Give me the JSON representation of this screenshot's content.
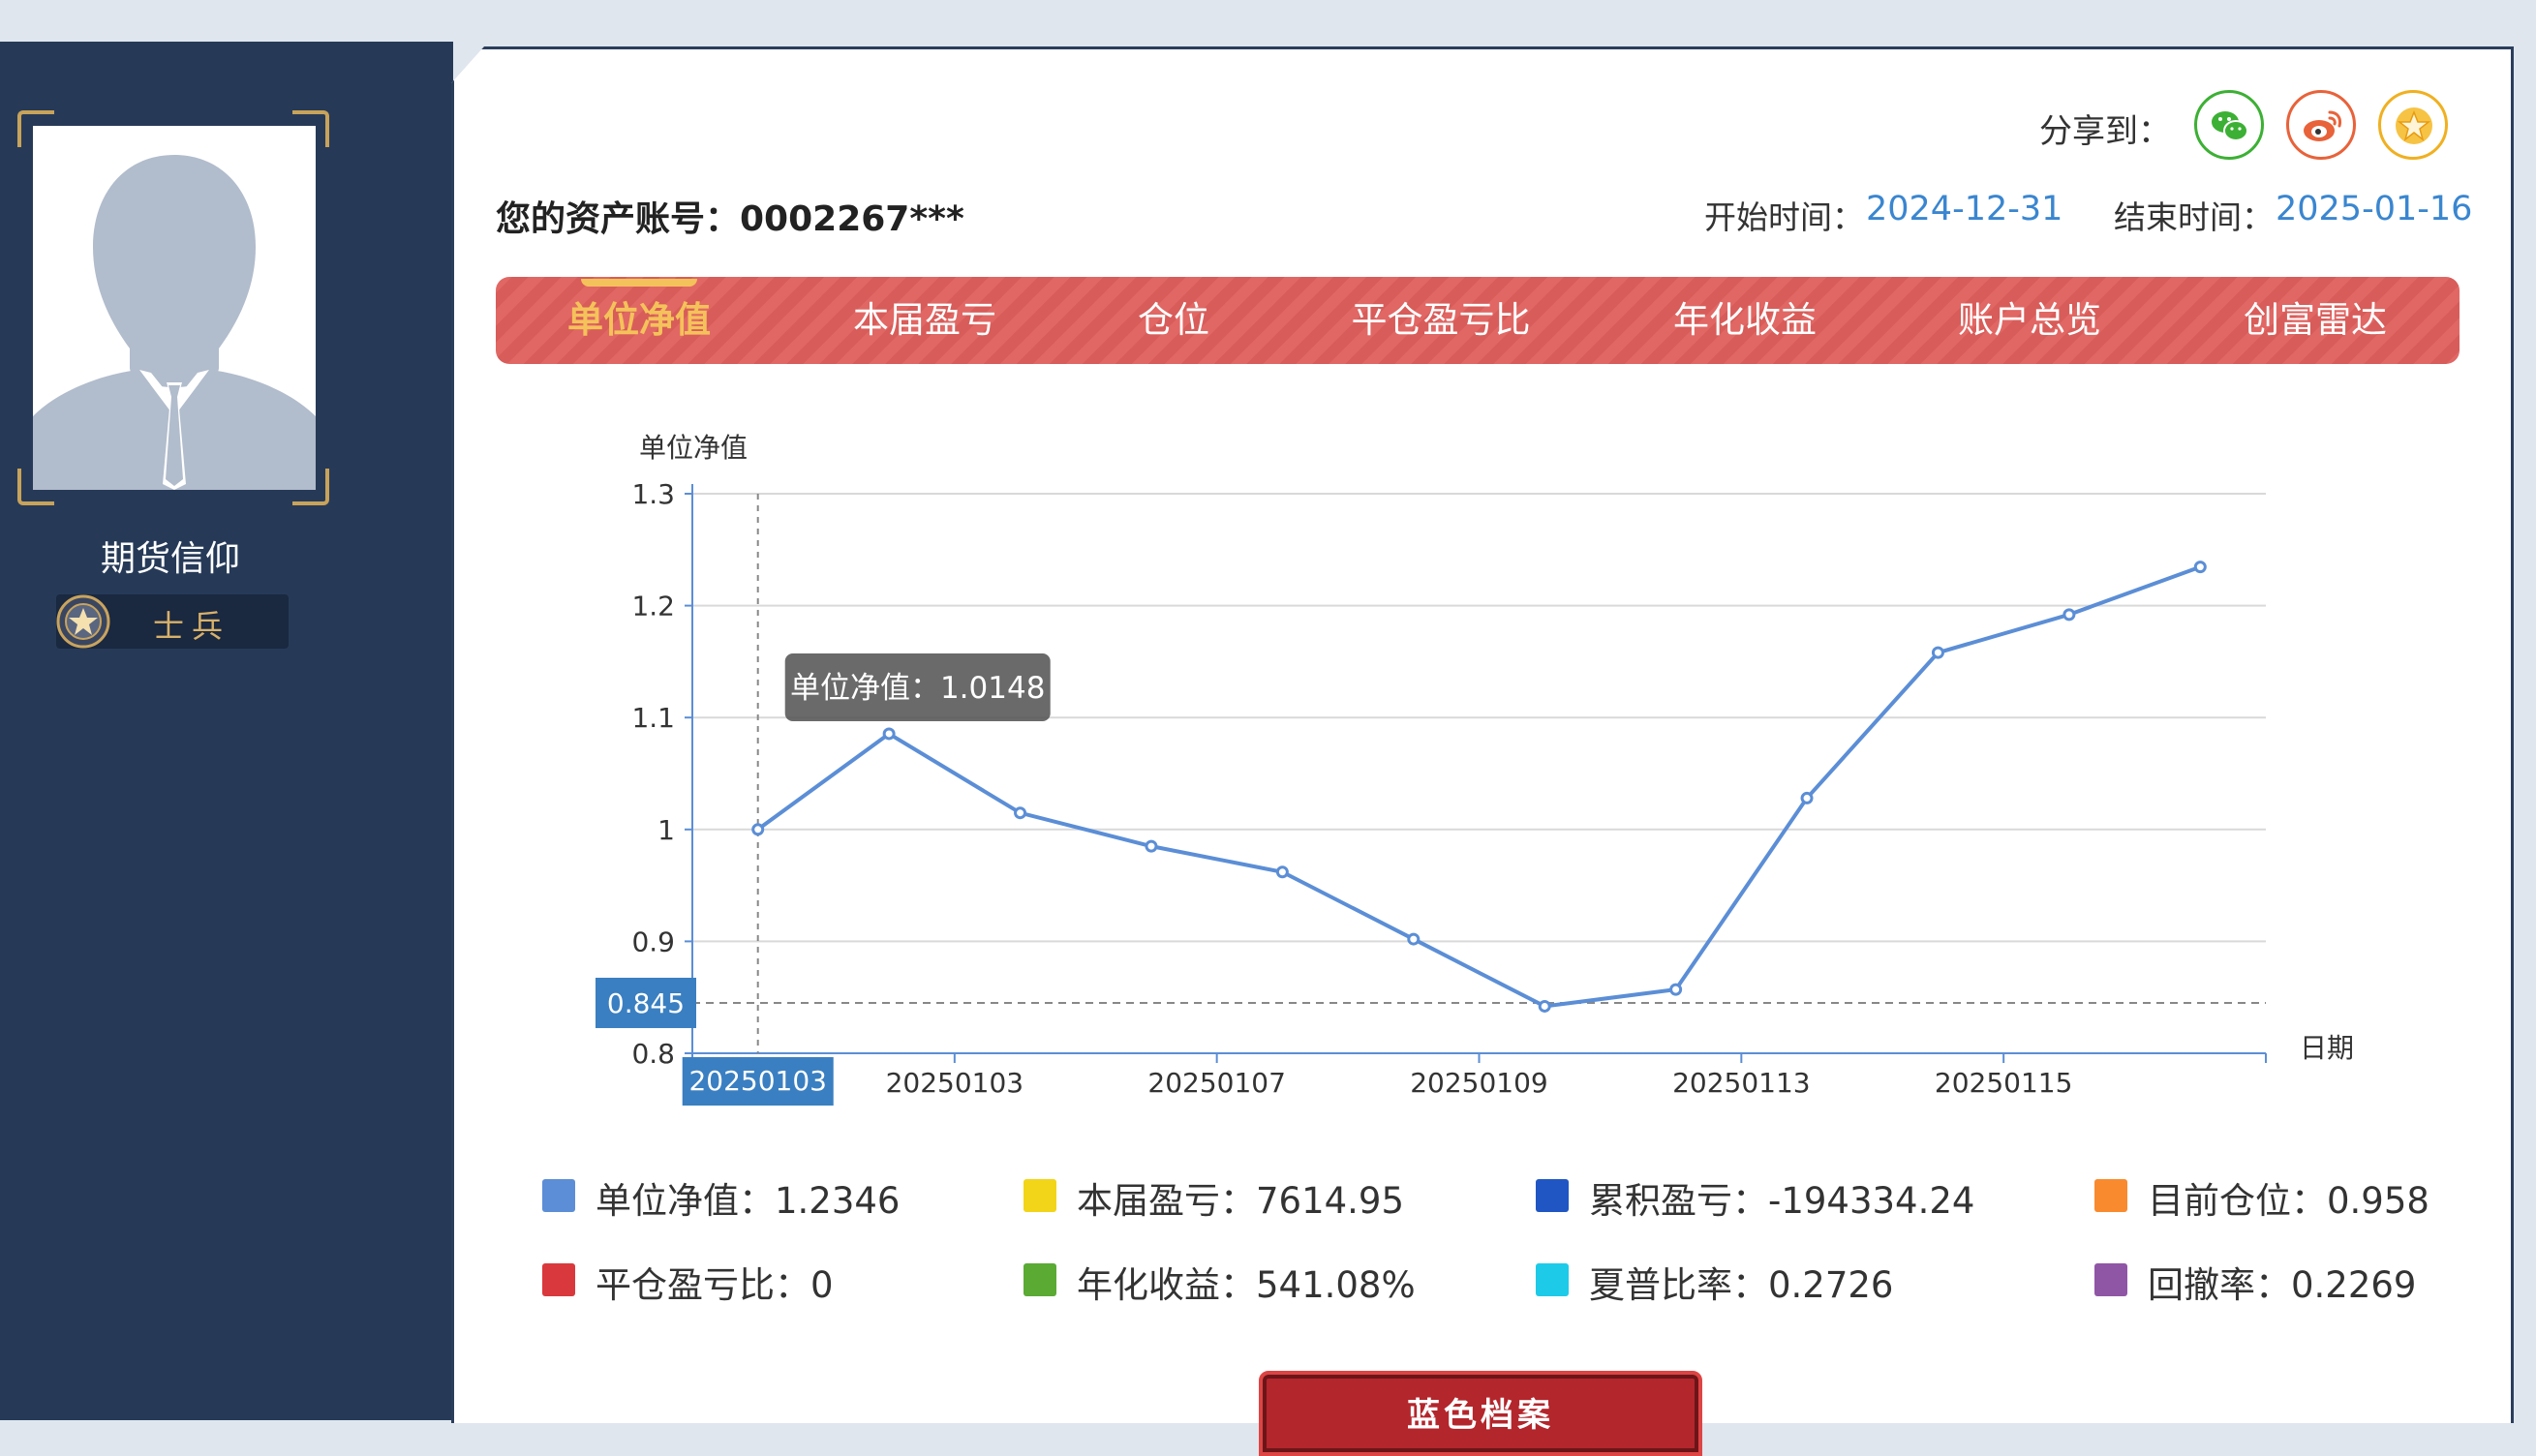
{
  "profile": {
    "username": "期货信仰",
    "rank": "士兵"
  },
  "share": {
    "label": "分享到：",
    "targets": [
      "wechat-icon",
      "weibo-icon",
      "favorite-icon"
    ]
  },
  "account": {
    "label": "您的资产账号：0002267***"
  },
  "period": {
    "start_label": "开始时间：",
    "start_value": "2024-12-31",
    "end_label": "结束时间：",
    "end_value": "2025-01-16"
  },
  "tabs": [
    {
      "label": "单位净值",
      "active": true
    },
    {
      "label": "本届盈亏",
      "active": false
    },
    {
      "label": "仓位",
      "active": false
    },
    {
      "label": "平仓盈亏比",
      "active": false
    },
    {
      "label": "年化收益",
      "active": false
    },
    {
      "label": "账户总览",
      "active": false
    },
    {
      "label": "创富雷达",
      "active": false
    }
  ],
  "chart_data": {
    "type": "line",
    "ylabel": "单位净值",
    "xlabel": "日期",
    "ylim": [
      0.8,
      1.3
    ],
    "yticks": [
      "0.8",
      "0.9",
      "1",
      "1.1",
      "1.2",
      "1.3"
    ],
    "xtick_labels": [
      "20250103",
      "20250107",
      "20250109",
      "20250113",
      "20250115"
    ],
    "series": [
      {
        "name": "单位净值",
        "color": "#5b8ed6",
        "values": [
          1.0,
          1.0855,
          1.0148,
          0.985,
          0.962,
          0.902,
          0.842,
          0.857,
          1.028,
          1.158,
          1.192,
          1.2346
        ]
      }
    ],
    "tooltip": "单位净值：1.0148",
    "crosshair_y_label": "0.845",
    "crosshair_x_label": "20250103",
    "crosshair_value": 0.845
  },
  "legend": [
    {
      "label": "单位净值：1.2346",
      "color": "#5b8ed6"
    },
    {
      "label": "本届盈亏：7614.95",
      "color": "#f2d518"
    },
    {
      "label": "累积盈亏：-194334.24",
      "color": "#1f56c4"
    },
    {
      "label": "目前仓位：0.958",
      "color": "#f98a2e"
    },
    {
      "label": "平仓盈亏比：0",
      "color": "#d9393c"
    },
    {
      "label": "年化收益：541.08%",
      "color": "#5aaa34"
    },
    {
      "label": "夏普比率：0.2726",
      "color": "#1dcbe8"
    },
    {
      "label": "回撤率：0.2269",
      "color": "#9056a6"
    }
  ],
  "archive_button": {
    "label": "蓝色档案"
  }
}
